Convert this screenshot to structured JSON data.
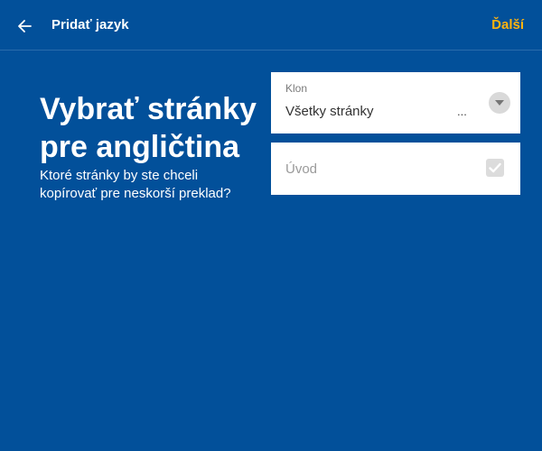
{
  "header": {
    "title": "Pridať jazyk",
    "next_label": "Ďalší"
  },
  "intro": {
    "heading_line1": "Vybrať stránky",
    "heading_line2": "pre angličtina",
    "subtitle_line1": "Ktoré stránky by ste chceli",
    "subtitle_line2": "kopírovať pre neskorší preklad?"
  },
  "clone_select": {
    "label": "Klon",
    "value": "Všetky stránky",
    "ellipsis": "..."
  },
  "pages": [
    {
      "label": "Úvod",
      "checked": true
    }
  ],
  "colors": {
    "background": "#02509a",
    "accent": "#ffb30f",
    "card": "#ffffff"
  },
  "icons": {
    "back": "arrow-left-icon",
    "dropdown": "chevron-down-icon",
    "checkbox": "check-icon"
  }
}
